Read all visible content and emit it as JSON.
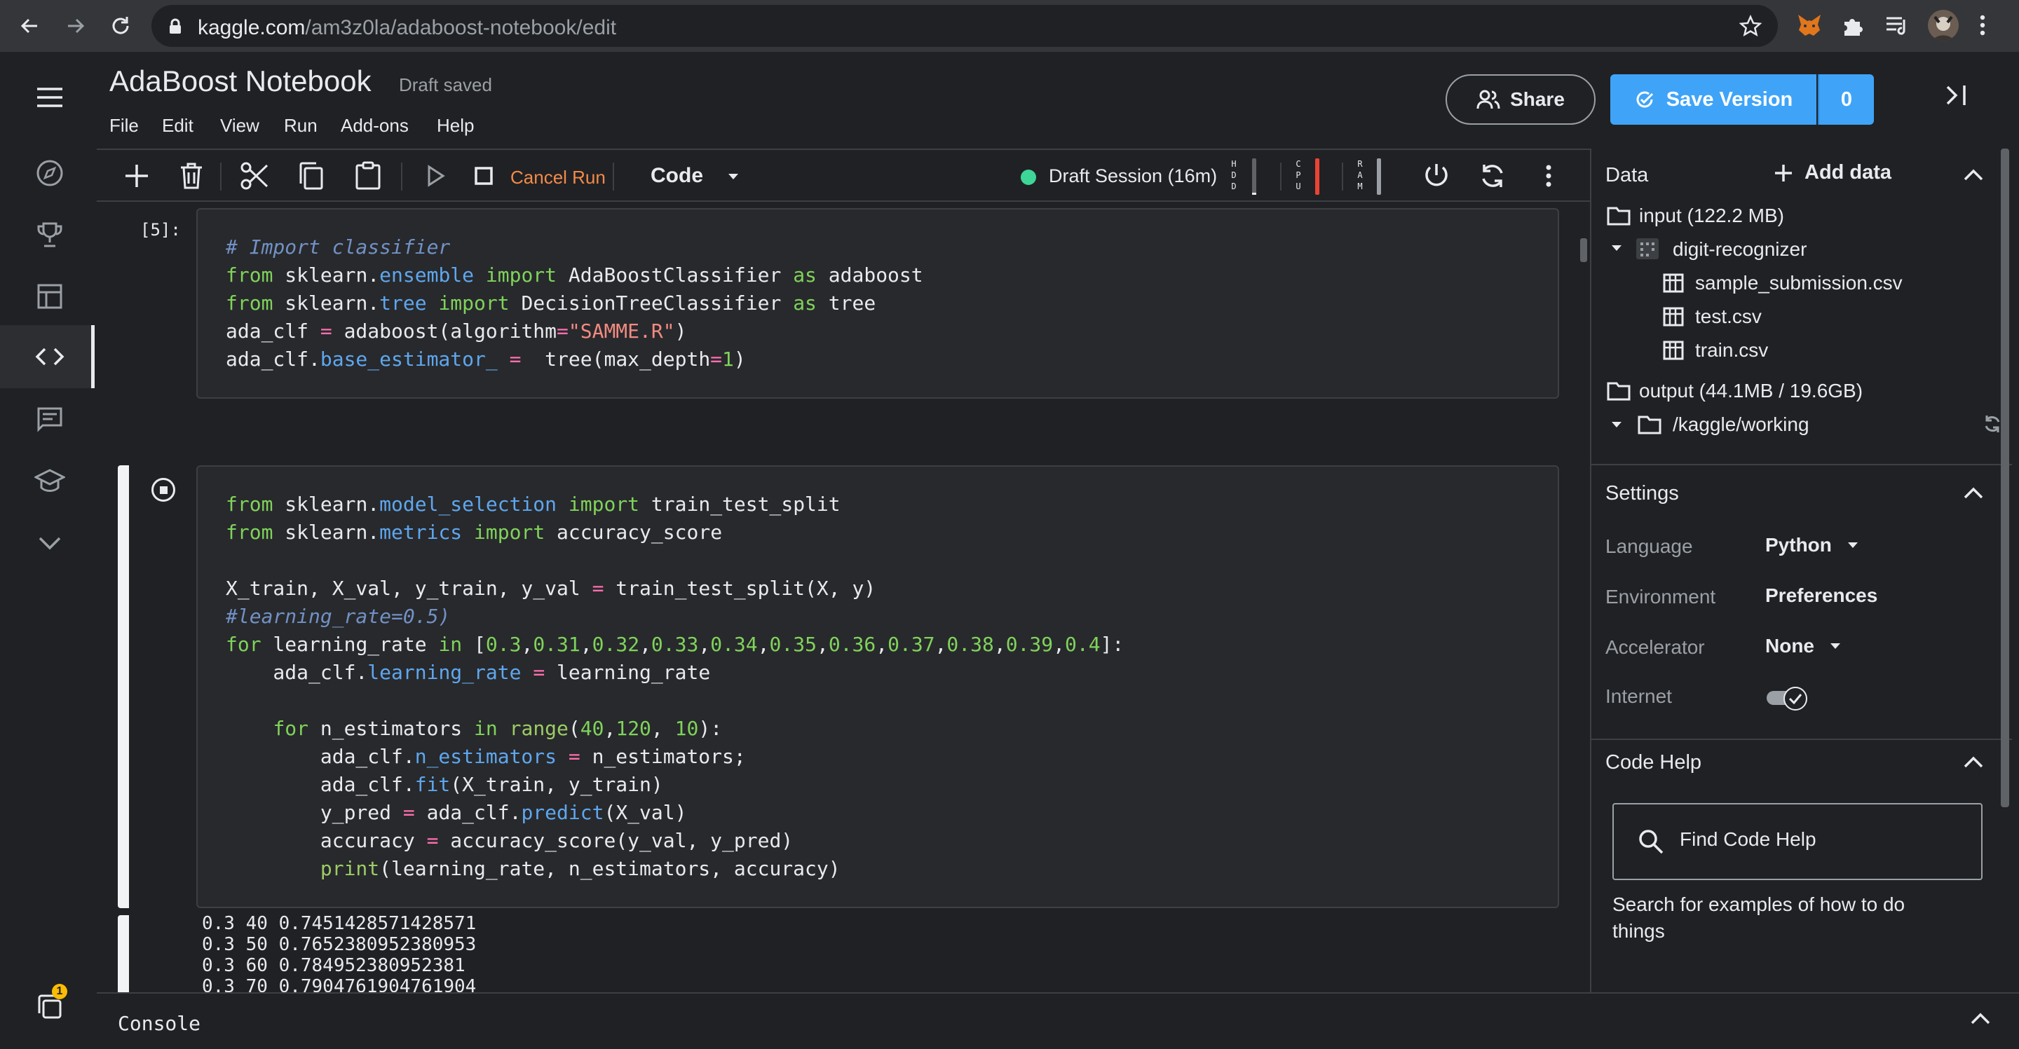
{
  "browser": {
    "url_domain": "kaggle.com",
    "url_path": "/am3z0la/adaboost-notebook/edit"
  },
  "header": {
    "title": "AdaBoost Notebook",
    "status": "Draft saved",
    "menu": [
      "File",
      "Edit",
      "View",
      "Run",
      "Add-ons",
      "Help"
    ],
    "share_label": "Share",
    "save_version_label": "Save Version",
    "save_version_count": "0"
  },
  "toolbar": {
    "cancel_run_label": "Cancel Run",
    "cell_type": "Code",
    "session_label": "Draft Session (16m)",
    "meters": {
      "hdd": {
        "label": "HDD",
        "level": 0.05
      },
      "cpu": {
        "label": "CPU",
        "level": 0.95
      },
      "ram": {
        "label": "RAM",
        "level": 0.15
      }
    },
    "colors": {
      "cancel": "#f28b48",
      "session_active": "#3ed598",
      "cpu_high": "#ea4335"
    }
  },
  "cells": [
    {
      "execution_count": "[5]:",
      "lines": [
        "# Import classifier",
        "from sklearn.ensemble import AdaBoostClassifier as adaboost",
        "from sklearn.tree import DecisionTreeClassifier as tree",
        "ada_clf = adaboost(algorithm=\"SAMME.R\")",
        "ada_clf.base_estimator_ =  tree(max_depth=1)"
      ]
    },
    {
      "execution_count": "",
      "lines": [
        "from sklearn.model_selection import train_test_split",
        "from sklearn.metrics import accuracy_score",
        "",
        "X_train, X_val, y_train, y_val = train_test_split(X, y)",
        "#learning_rate=0.5)",
        "for learning_rate in [0.3,0.31,0.32,0.33,0.34,0.35,0.36,0.37,0.38,0.39,0.4]:",
        "    ada_clf.learning_rate = learning_rate",
        "",
        "    for n_estimators in range(40,120, 10):",
        "        ada_clf.n_estimators = n_estimators;",
        "        ada_clf.fit(X_train, y_train)",
        "        y_pred = ada_clf.predict(X_val)",
        "        accuracy = accuracy_score(y_val, y_pred)",
        "        print(learning_rate, n_estimators, accuracy)"
      ],
      "output": [
        "0.3 40 0.7451428571428571",
        "0.3 50 0.7652380952380953",
        "0.3 60 0.784952380952381",
        "0.3 70 0.7904761904761904"
      ]
    }
  ],
  "console": {
    "label": "Console"
  },
  "right_panel": {
    "data": {
      "heading": "Data",
      "add_data_label": "Add data",
      "input_label": "input (122.2 MB)",
      "dataset": "digit-recognizer",
      "files": [
        "sample_submission.csv",
        "test.csv",
        "train.csv"
      ],
      "output_label": "output (44.1MB / 19.6GB)",
      "working_dir": "/kaggle/working"
    },
    "settings": {
      "heading": "Settings",
      "language_label": "Language",
      "language_value": "Python",
      "environment_label": "Environment",
      "environment_value": "Preferences",
      "accelerator_label": "Accelerator",
      "accelerator_value": "None",
      "internet_label": "Internet",
      "internet_on": true
    },
    "code_help": {
      "heading": "Code Help",
      "search_placeholder": "Find Code Help",
      "description_line1": "Search for examples of how to do",
      "description_line2": "things"
    }
  },
  "left_rail": {
    "items": [
      "menu-icon",
      "compass-icon",
      "trophy-icon",
      "table-icon",
      "code-icon",
      "comments-icon",
      "graduation-cap-icon",
      "chevron-down-icon"
    ],
    "notification_count": "1"
  },
  "colors": {
    "accent": "#3fa4f8",
    "background": "#202124",
    "cell_bg": "#28292c"
  }
}
